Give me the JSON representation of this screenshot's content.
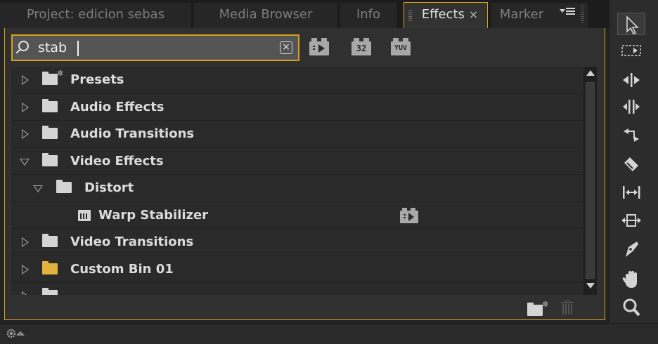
{
  "tabs": [
    {
      "label": "Project: edicion sebas",
      "active": false
    },
    {
      "label": "Media Browser",
      "active": false
    },
    {
      "label": "Info",
      "active": false
    },
    {
      "label": "Effects",
      "active": true,
      "close": "×"
    },
    {
      "label": "Marker",
      "active": false
    }
  ],
  "search": {
    "value": "stab",
    "clear_label": "×"
  },
  "filters": {
    "accelerated_label": "",
    "bit32_label": "32",
    "yuv_label": "YUV"
  },
  "tree": [
    {
      "label": "Presets",
      "expanded": false,
      "kind": "preset-folder"
    },
    {
      "label": "Audio Effects",
      "expanded": false,
      "kind": "folder"
    },
    {
      "label": "Audio Transitions",
      "expanded": false,
      "kind": "folder"
    },
    {
      "label": "Video Effects",
      "expanded": true,
      "kind": "folder"
    },
    {
      "label": "Distort",
      "expanded": true,
      "kind": "folder"
    },
    {
      "label": "Warp Stabilizer",
      "kind": "effect",
      "accelerated": true
    },
    {
      "label": "Video Transitions",
      "expanded": false,
      "kind": "folder"
    },
    {
      "label": "Custom Bin 01",
      "expanded": false,
      "kind": "custom-bin",
      "color": "#e3b23c"
    }
  ],
  "tools": [
    "selection-tool",
    "track-select-tool",
    "ripple-edit-tool",
    "rolling-edit-tool",
    "rate-stretch-tool",
    "razor-tool",
    "slip-tool",
    "slide-tool",
    "pen-tool",
    "hand-tool",
    "zoom-tool"
  ],
  "colors": {
    "accent": "#d4a020",
    "panel": "#303030",
    "tree_bg": "#2a2a2a",
    "custom_bin": "#e3b23c"
  }
}
